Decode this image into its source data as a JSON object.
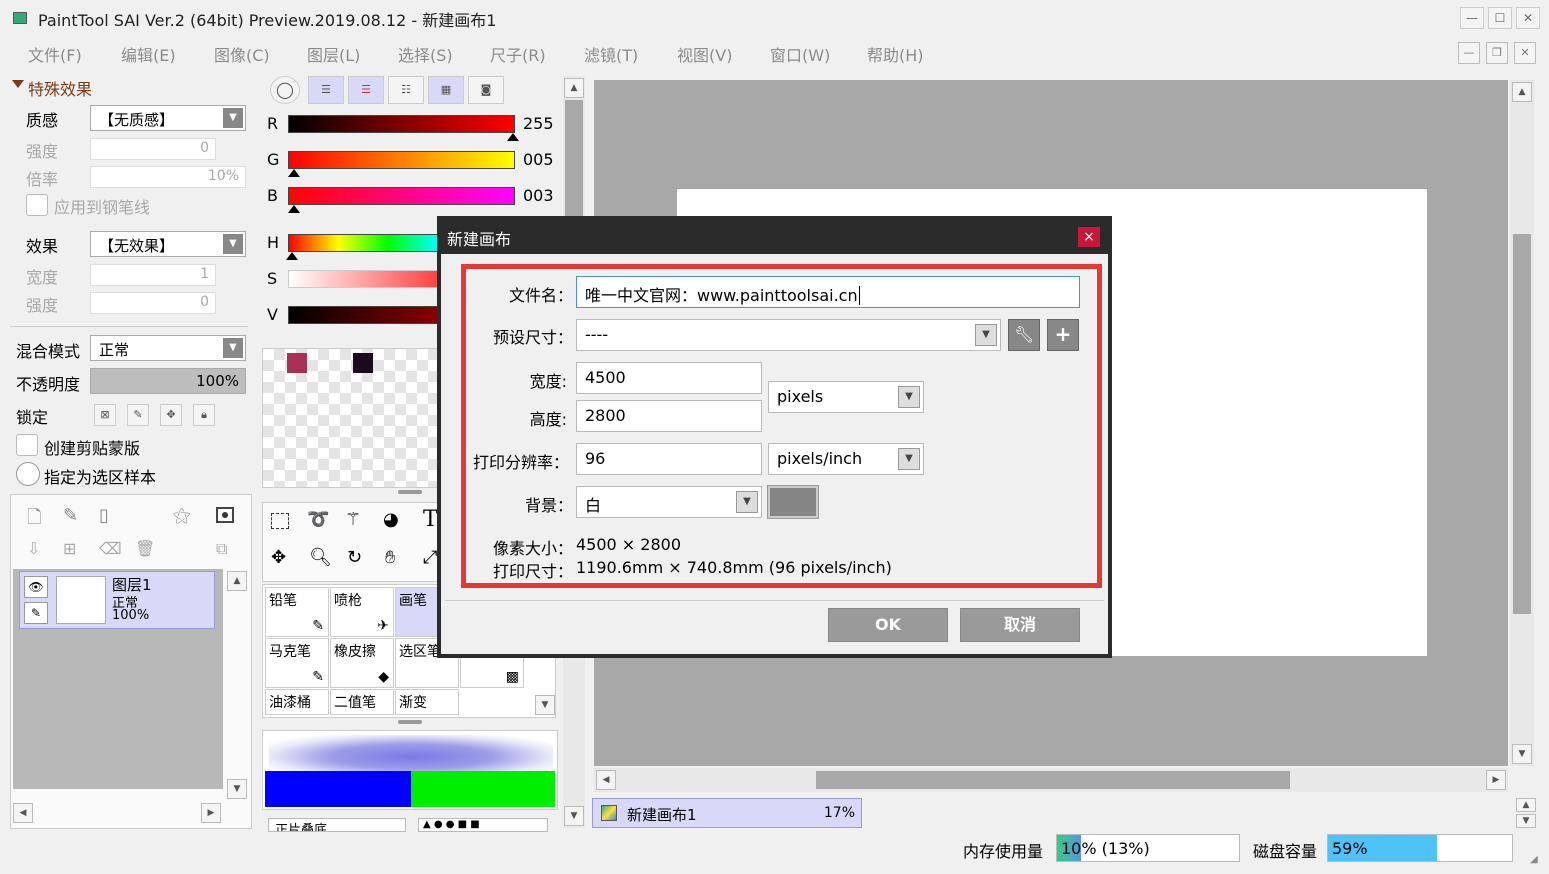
{
  "window": {
    "title": "PaintTool SAI Ver.2 (64bit) Preview.2019.08.12 - 新建画布1",
    "min": "—",
    "max": "☐",
    "close": "✕"
  },
  "menu": [
    "文件(F)",
    "编辑(E)",
    "图像(C)",
    "图层(L)",
    "选择(S)",
    "尺子(R)",
    "滤镜(T)",
    "视图(V)",
    "窗口(W)",
    "帮助(H)"
  ],
  "effects": {
    "header": "特殊效果",
    "texture_label": "质感",
    "texture_value": "【无质感】",
    "strength_label": "强度",
    "strength_value": "0",
    "scale_label": "倍率",
    "scale_value": "10%",
    "apply_pen": "应用到钢笔线",
    "effect_label": "效果",
    "effect_value": "【无效果】",
    "width_label": "宽度",
    "width_value": "1",
    "strength2_label": "强度",
    "strength2_value": "0"
  },
  "layer_props": {
    "blend_label": "混合模式",
    "blend_value": "正常",
    "opacity_label": "不透明度",
    "opacity_value": "100%",
    "opacity_fraction": 1.0,
    "lock_label": "锁定",
    "clip": "创建剪贴蒙版",
    "sel_source": "指定为选区样本"
  },
  "layer": {
    "name": "图层1",
    "mode": "正常",
    "opacity": "100%"
  },
  "color": {
    "r_label": "R",
    "r_value": "255",
    "g_label": "G",
    "g_value": "005",
    "b_label": "B",
    "b_value": "003",
    "h_label": "H",
    "s_label": "S",
    "v_label": "V",
    "swatches": [
      "#a83255",
      "#1a0a1e"
    ]
  },
  "tools": {
    "text_tool": "T",
    "brushes": [
      [
        "铅笔",
        "喷枪",
        "画笔"
      ],
      [
        "马克笔",
        "橡皮擦",
        "选区笔"
      ],
      [
        "油漆桶",
        "二值笔",
        "渐变"
      ]
    ],
    "brush_mode": "正片叠底"
  },
  "canvas_tab": {
    "name": "新建画布1",
    "zoom": "17%"
  },
  "status": {
    "memory_label": "内存使用量",
    "memory_value": "10% (13%)",
    "memory_fraction": 0.13,
    "disk_label": "磁盘容量",
    "disk_value": "59%",
    "disk_fraction": 0.59
  },
  "dialog": {
    "title": "新建画布",
    "close": "×",
    "filename_label": "文件名：",
    "filename_value": "唯一中文官网：www.painttoolsai.cn",
    "preset_label": "预设尺寸：",
    "preset_value": "----",
    "width_label": "宽度:",
    "width_value": "4500",
    "height_label": "高度:",
    "height_value": "2800",
    "unit_value": "pixels",
    "dpi_label": "打印分辨率：",
    "dpi_value": "96",
    "dpi_unit": "pixels/inch",
    "bg_label": "背景：",
    "bg_value": "白",
    "pixel_size_label": "像素大小：",
    "pixel_size_value": "4500 × 2800",
    "print_size_label": "打印尺寸：",
    "print_size_value": "1190.6mm × 740.8mm (96 pixels/inch)",
    "ok": "OK",
    "cancel": "取消"
  },
  "colors": {
    "highlight": "#e53935",
    "dialog_title": "#2b2b2b",
    "close_btn": "#c8173c",
    "selection": "#d8d8f8"
  }
}
